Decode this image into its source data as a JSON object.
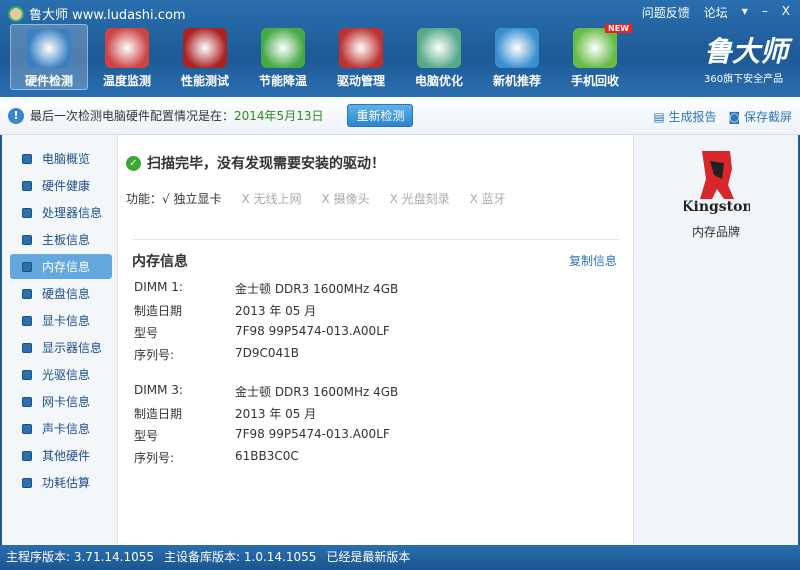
{
  "title": "鲁大师 www.ludashi.com",
  "titlebar": {
    "feedback": "问题反馈",
    "forum": "论坛",
    "menu": "▾",
    "minimize": "–",
    "close": "X"
  },
  "toolbar": [
    {
      "label": "硬件检测",
      "color": "#3a7fc0"
    },
    {
      "label": "温度监测",
      "color": "#c44"
    },
    {
      "label": "性能测试",
      "color": "#a22"
    },
    {
      "label": "节能降温",
      "color": "#4a4"
    },
    {
      "label": "驱动管理",
      "color": "#b33"
    },
    {
      "label": "电脑优化",
      "color": "#5a8"
    },
    {
      "label": "新机推荐",
      "color": "#3a8fd0"
    },
    {
      "label": "手机回收",
      "color": "#6b4"
    }
  ],
  "new_badge": "NEW",
  "brand": {
    "name": "鲁大师",
    "sub": "360旗下安全产品"
  },
  "info": {
    "text": "最后一次检测电脑硬件配置情况是在：",
    "date": "2014年5月13日",
    "recheck": "重新检测",
    "report": "生成报告",
    "screenshot": "保存截屏"
  },
  "sidebar": [
    "电脑概览",
    "硬件健康",
    "处理器信息",
    "主板信息",
    "内存信息",
    "硬盘信息",
    "显卡信息",
    "显示器信息",
    "光驱信息",
    "网卡信息",
    "声卡信息",
    "其他硬件",
    "功耗估算"
  ],
  "sidebar_active": 4,
  "main": {
    "scan_msg": "扫描完毕，没有发现需要安装的驱动！",
    "features_label": "功能：",
    "features": [
      {
        "t": "√ 独立显卡",
        "on": true
      },
      {
        "t": "X 无线上网",
        "on": false
      },
      {
        "t": "X 摄像头",
        "on": false
      },
      {
        "t": "X 光盘刻录",
        "on": false
      },
      {
        "t": "X 蓝牙",
        "on": false
      }
    ],
    "section": "内存信息",
    "copy": "复制信息",
    "rows": [
      [
        "DIMM 1:",
        "金士顿 DDR3 1600MHz 4GB"
      ],
      [
        "制造日期",
        "2013 年 05 月"
      ],
      [
        "型号",
        "7F98 99P5474-013.A00LF"
      ],
      [
        "序列号:",
        "7D9C041B"
      ],
      [
        "DIMM 3:",
        "金士顿 DDR3 1600MHz 4GB"
      ],
      [
        "制造日期",
        "2013 年 05 月"
      ],
      [
        "型号",
        "7F98 99P5474-013.A00LF"
      ],
      [
        "序列号:",
        "61BB3C0C"
      ]
    ]
  },
  "right": {
    "logo": "Kingston",
    "label": "内存品牌"
  },
  "status": [
    "主程序版本: 3.71.14.1055",
    "主设备库版本: 1.0.14.1055",
    "已经是最新版本"
  ]
}
